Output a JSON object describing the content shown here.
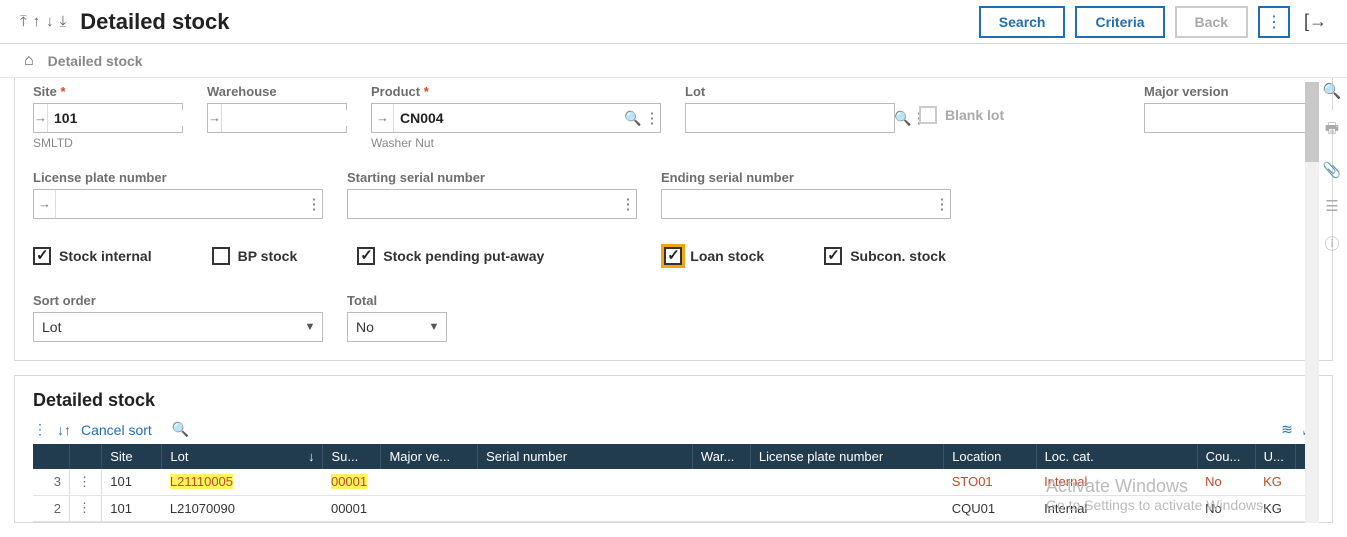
{
  "header": {
    "title": "Detailed stock",
    "buttons": {
      "search": "Search",
      "criteria": "Criteria",
      "back": "Back"
    }
  },
  "breadcrumb": {
    "text": "Detailed stock"
  },
  "filters": {
    "site": {
      "label": "Site",
      "value": "101",
      "desc": "SMLTD"
    },
    "warehouse": {
      "label": "Warehouse",
      "value": ""
    },
    "product": {
      "label": "Product",
      "value": "CN004",
      "desc": "Washer Nut"
    },
    "lot": {
      "label": "Lot",
      "value": ""
    },
    "blanklot": {
      "label": "Blank lot"
    },
    "majorversion": {
      "label": "Major version",
      "value": ""
    },
    "lpn": {
      "label": "License plate number",
      "value": ""
    },
    "start_serial": {
      "label": "Starting serial number",
      "value": ""
    },
    "end_serial": {
      "label": "Ending serial number",
      "value": ""
    }
  },
  "checks": {
    "stock_internal": "Stock internal",
    "bp_stock": "BP stock",
    "stock_pending": "Stock pending put-away",
    "loan_stock": "Loan stock",
    "subcon": "Subcon. stock"
  },
  "selects": {
    "sort_label": "Sort order",
    "sort_value": "Lot",
    "total_label": "Total",
    "total_value": "No"
  },
  "results": {
    "title": "Detailed stock",
    "cancel_sort": "Cancel sort",
    "columns": {
      "site": "Site",
      "lot": "Lot",
      "su": "Su...",
      "major": "Major ve...",
      "serial": "Serial number",
      "war": "War...",
      "lpn": "License plate number",
      "location": "Location",
      "loccat": "Loc. cat.",
      "cou": "Cou...",
      "u": "U..."
    },
    "rows": [
      {
        "n": "3",
        "site": "101",
        "lot": "L21110005",
        "su": "00001",
        "location": "STO01",
        "loccat": "Internal",
        "cou": "No",
        "u": "KG",
        "highlight": true
      },
      {
        "n": "2",
        "site": "101",
        "lot": "L21070090",
        "su": "00001",
        "location": "CQU01",
        "loccat": "Internal",
        "cou": "No",
        "u": "KG",
        "highlight": false
      }
    ]
  },
  "watermark": {
    "l1": "Activate Windows",
    "l2": "Go to Settings to activate Windows."
  }
}
